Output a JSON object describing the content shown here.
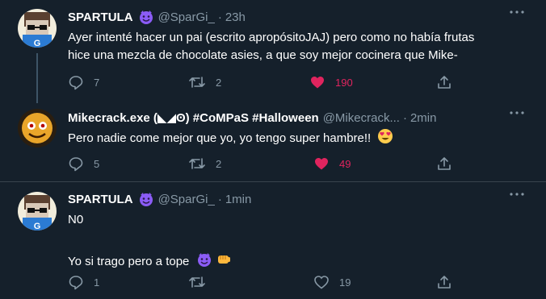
{
  "tweets": [
    {
      "name": "SPARTULA",
      "handle": "@SparGi_",
      "dot": "·",
      "time": "23h",
      "text_lines": [
        "Ayer intenté hacer un pai (escrito apropósitoJAJ) pero como no había frutas",
        "hice una mezcla de chocolate asies, a que soy mejor cocinera que Mike-"
      ],
      "replies": "7",
      "retweets": "2",
      "likes": "190",
      "liked": true
    },
    {
      "name": "Mikecrack.exe (◣◢ʘ) #CoMPaS #Halloween",
      "handle": "@Mikecrack...",
      "dot": "·",
      "time": "2min",
      "text": "Pero nadie come mejor que yo, yo tengo super hambre!!",
      "replies": "5",
      "retweets": "2",
      "likes": "49",
      "liked": true
    },
    {
      "name": "SPARTULA",
      "handle": "@SparGi_",
      "dot": "·",
      "time": "1min",
      "text_line1": "N0",
      "text_line2": "Yo si trago pero a tope",
      "replies": "1",
      "retweets": "",
      "likes": "19",
      "liked": false
    }
  ],
  "colors": {
    "background": "#15202b",
    "muted": "#8899a6",
    "like": "#e0245e",
    "badge": "#8b5cf6"
  },
  "icons": [
    "smiling-devil-icon",
    "reply-icon",
    "retweet-icon",
    "heart-icon",
    "share-icon",
    "more-icon",
    "heart-eyes-emoji",
    "fist-emoji"
  ]
}
